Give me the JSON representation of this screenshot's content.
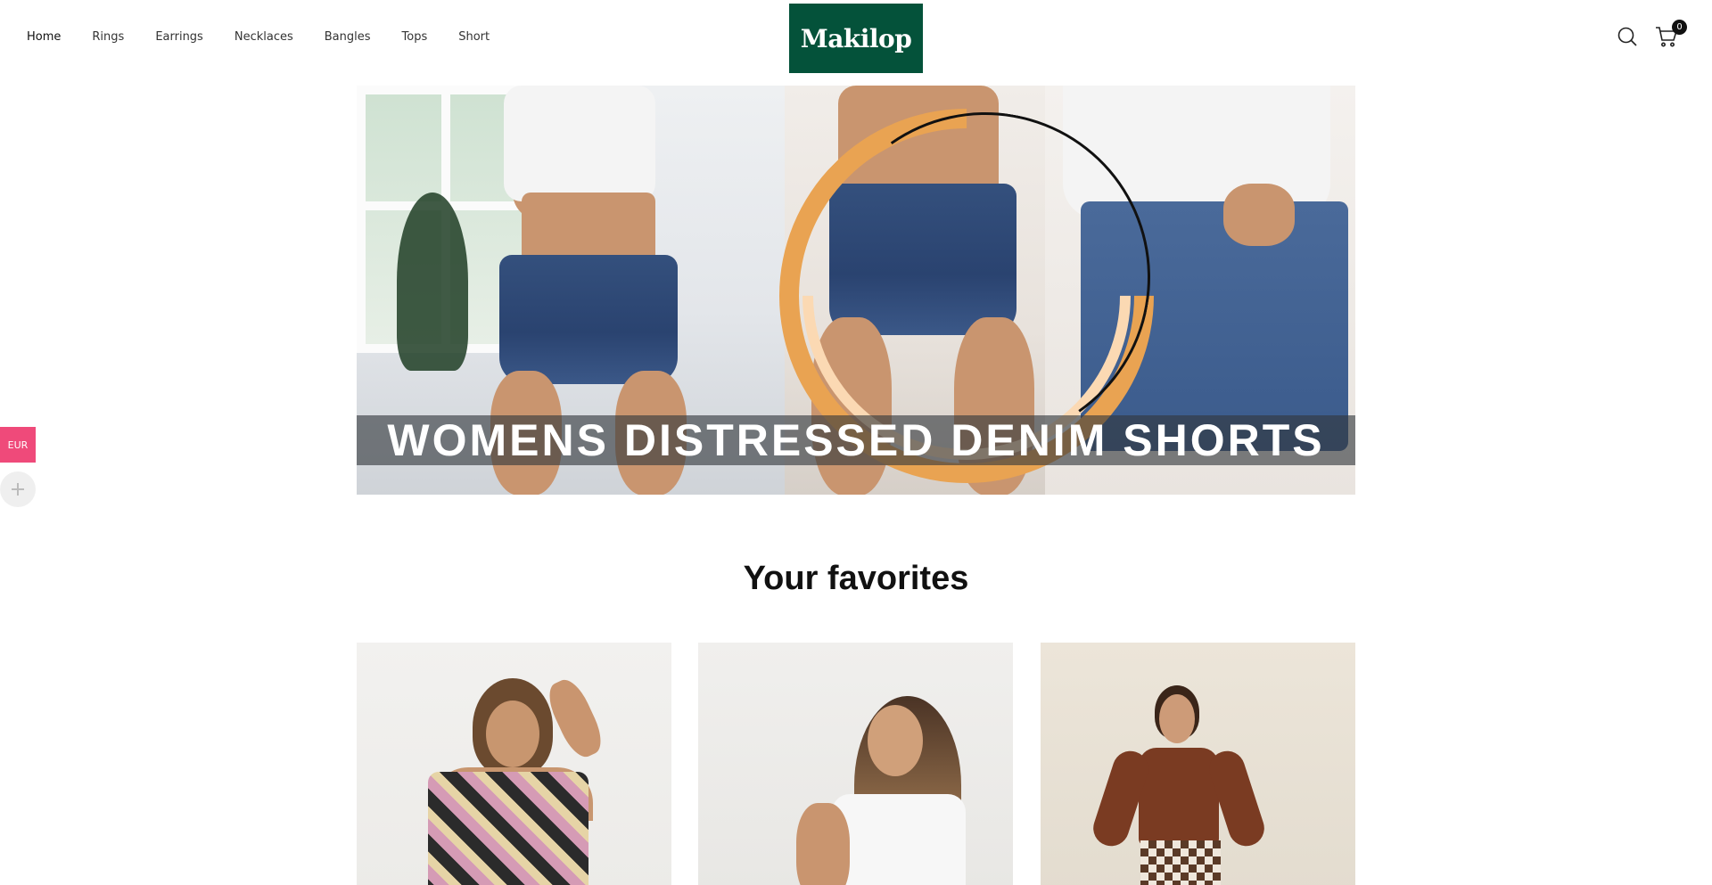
{
  "header": {
    "nav": [
      {
        "label": "Home",
        "active": true
      },
      {
        "label": "Rings"
      },
      {
        "label": "Earrings"
      },
      {
        "label": "Necklaces"
      },
      {
        "label": "Bangles"
      },
      {
        "label": "Tops"
      },
      {
        "label": "Short"
      }
    ],
    "logo_text": "Makilop",
    "logo_bg": "#04523a",
    "cart_count": "0",
    "icons": [
      "search-icon",
      "cart-icon"
    ]
  },
  "hero": {
    "banner_text": "WOMENS DISTRESSED DENIM SHORTS",
    "accent_ring": "#e9a352"
  },
  "side": {
    "currency": "EUR",
    "currency_bg": "#ef4a7a"
  },
  "favorites": {
    "title": "Your favorites",
    "products": [
      {
        "image": "crochet-top-model"
      },
      {
        "image": "white-tank-model"
      },
      {
        "image": "brown-top-checkered-shorts-model"
      }
    ]
  }
}
